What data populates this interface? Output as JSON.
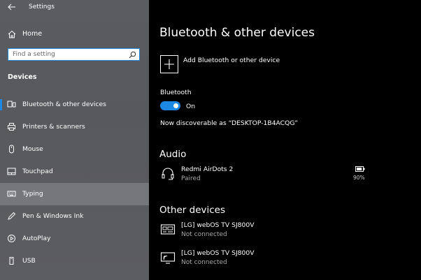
{
  "app": {
    "title": "Settings"
  },
  "sidebar": {
    "home_label": "Home",
    "search_placeholder": "Find a setting",
    "section_title": "Devices",
    "items": [
      {
        "label": "Bluetooth & other devices",
        "icon": "bluetooth-devices-icon",
        "active": true
      },
      {
        "label": "Printers & scanners",
        "icon": "printer-icon"
      },
      {
        "label": "Mouse",
        "icon": "mouse-icon"
      },
      {
        "label": "Touchpad",
        "icon": "touchpad-icon"
      },
      {
        "label": "Typing",
        "icon": "keyboard-icon",
        "hover": true
      },
      {
        "label": "Pen & Windows Ink",
        "icon": "pen-icon"
      },
      {
        "label": "AutoPlay",
        "icon": "autoplay-icon"
      },
      {
        "label": "USB",
        "icon": "usb-icon"
      }
    ]
  },
  "main": {
    "title": "Bluetooth & other devices",
    "add_label": "Add Bluetooth or other device",
    "bluetooth_label": "Bluetooth",
    "toggle_state": "On",
    "discoverable_text": "Now discoverable as “DESKTOP-1B4ACQG”",
    "audio_title": "Audio",
    "audio_devices": [
      {
        "name": "Redmi AirDots 2",
        "status": "Paired",
        "battery": "90%",
        "battery_level": 0.9,
        "icon": "headset-icon"
      }
    ],
    "other_title": "Other devices",
    "other_devices": [
      {
        "name": "[LG] webOS TV SJ800V",
        "status": "Not connected",
        "icon": "media-device-icon"
      },
      {
        "name": "[LG] webOS TV SJ800V",
        "status": "Not connected",
        "icon": "wireless-display-icon"
      }
    ]
  },
  "colors": {
    "accent": "#1e88e5",
    "sidebar_bg": "#5a5c5f",
    "main_bg": "#000000"
  }
}
